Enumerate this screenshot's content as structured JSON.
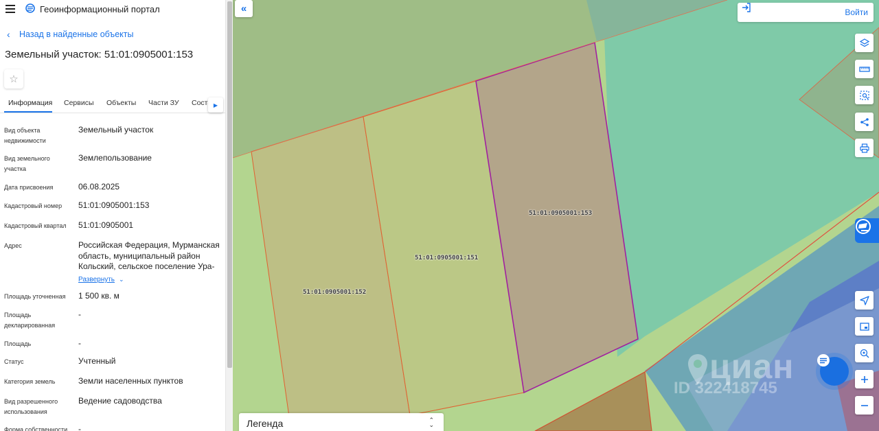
{
  "header": {
    "app_title": "Геоинформационный портал"
  },
  "nav": {
    "back_label": "Назад в найденные объекты"
  },
  "page": {
    "title": "Земельный участок: 51:01:0905001:153"
  },
  "tabs": [
    {
      "label": "Информация",
      "active": true
    },
    {
      "label": "Сервисы"
    },
    {
      "label": "Объекты"
    },
    {
      "label": "Части ЗУ"
    },
    {
      "label": "Соста"
    }
  ],
  "properties": [
    {
      "label": "Вид объекта недвижимости",
      "value": "Земельный участок"
    },
    {
      "label": "Вид земельного участка",
      "value": "Землепользование"
    },
    {
      "label": "Дата присвоения",
      "value": "06.08.2025"
    },
    {
      "label": "Кадастровый номер",
      "value": "51:01:0905001:153"
    },
    {
      "label": "Кадастровый квартал",
      "value": "51:01:0905001"
    },
    {
      "label": "Адрес",
      "value": "Российская Федерация, Мурманская область, муниципальный район Кольский, сельское поселение Ура-",
      "expand_label": "Развернуть"
    },
    {
      "label": "Площадь уточненная",
      "value": "1 500 кв. м"
    },
    {
      "label": "Площадь декларированная",
      "value": "-"
    },
    {
      "label": "Площадь",
      "value": "-"
    },
    {
      "label": "Статус",
      "value": "Учтенный"
    },
    {
      "label": "Категория земель",
      "value": "Земли населенных пунктов"
    },
    {
      "label": "Вид разрешенного использования",
      "value": "Ведение садоводства"
    },
    {
      "label": "Форма собственности",
      "value": "-"
    }
  ],
  "map": {
    "login_label": "Войти",
    "legend_label": "Легенда",
    "parcels": [
      {
        "label": "51:01:0905001:153"
      },
      {
        "label": "51:01:0905001:151"
      },
      {
        "label": "51:01:0905001:152"
      }
    ],
    "watermark": {
      "logo": "циан",
      "id": "ID 322418745"
    },
    "tools": [
      "layers-icon",
      "ruler-icon",
      "select-area-icon",
      "share-icon",
      "print-icon",
      "locate-icon",
      "minimap-icon",
      "geo-search-icon",
      "zoom-in-icon",
      "zoom-out-icon"
    ]
  },
  "colors": {
    "accent": "#1a73e8",
    "parcel_selected_border": "#a020a0",
    "parcel_border": "#e06030"
  }
}
